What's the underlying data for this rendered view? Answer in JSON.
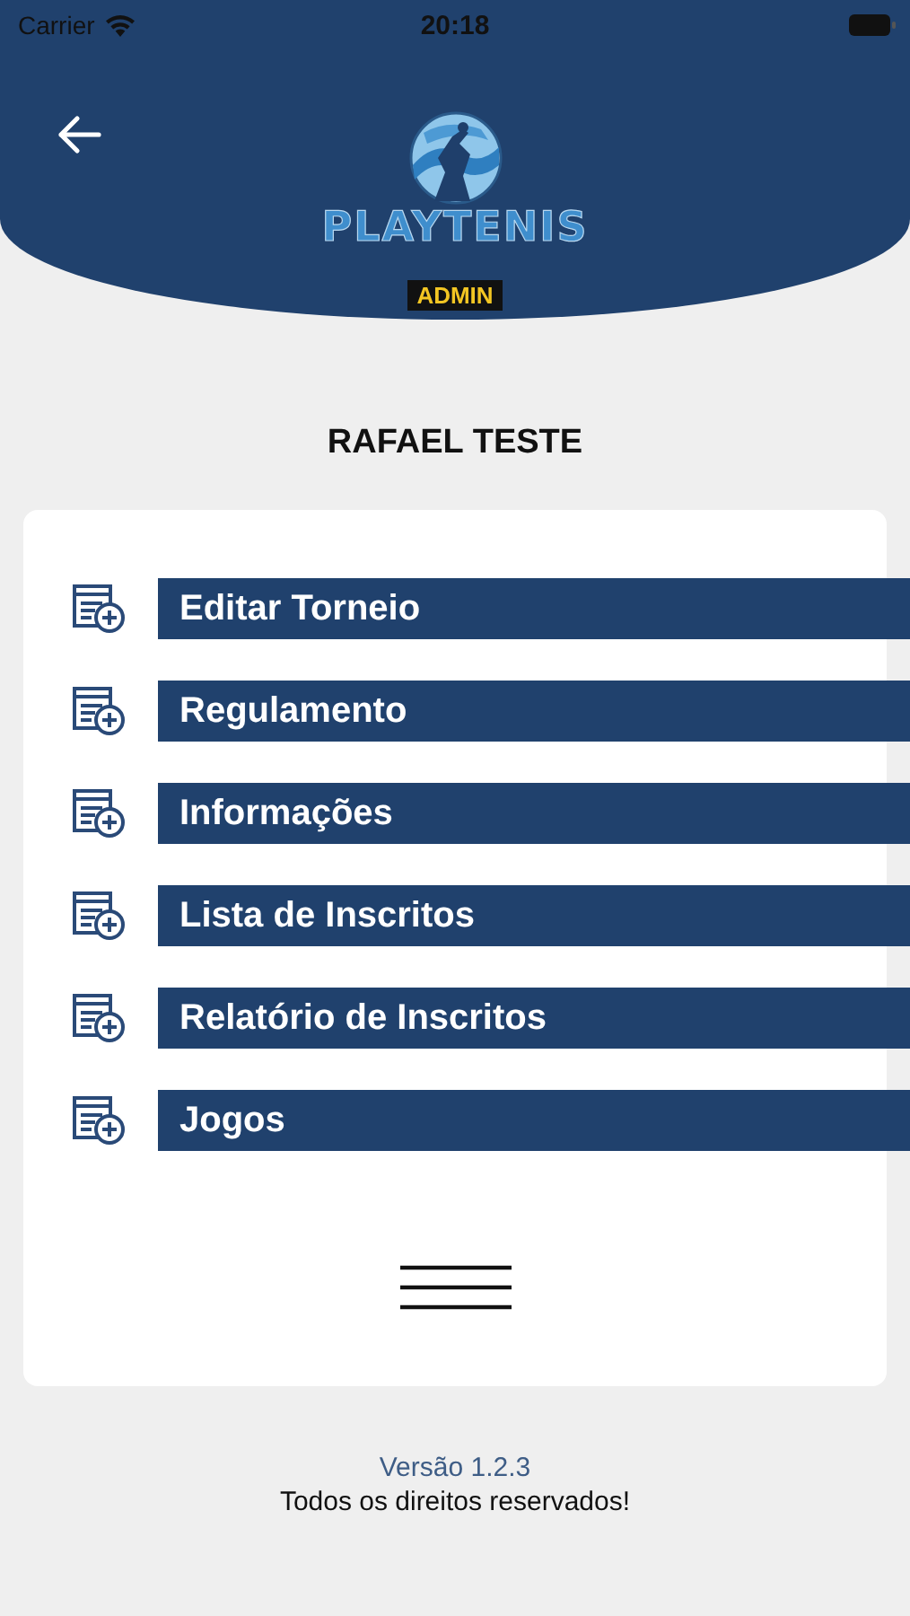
{
  "status_bar": {
    "carrier": "Carrier",
    "time": "20:18"
  },
  "header": {
    "logo_text": "PLAYTENIS",
    "badge": "ADMIN"
  },
  "user_name": "RAFAEL TESTE",
  "menu_items": [
    {
      "label": "Editar Torneio"
    },
    {
      "label": "Regulamento"
    },
    {
      "label": "Informações"
    },
    {
      "label": "Lista de Inscritos"
    },
    {
      "label": "Relatório de Inscritos"
    },
    {
      "label": "Jogos"
    }
  ],
  "footer": {
    "version": "Versão 1.2.3",
    "rights": "Todos os direitos reservados!"
  }
}
